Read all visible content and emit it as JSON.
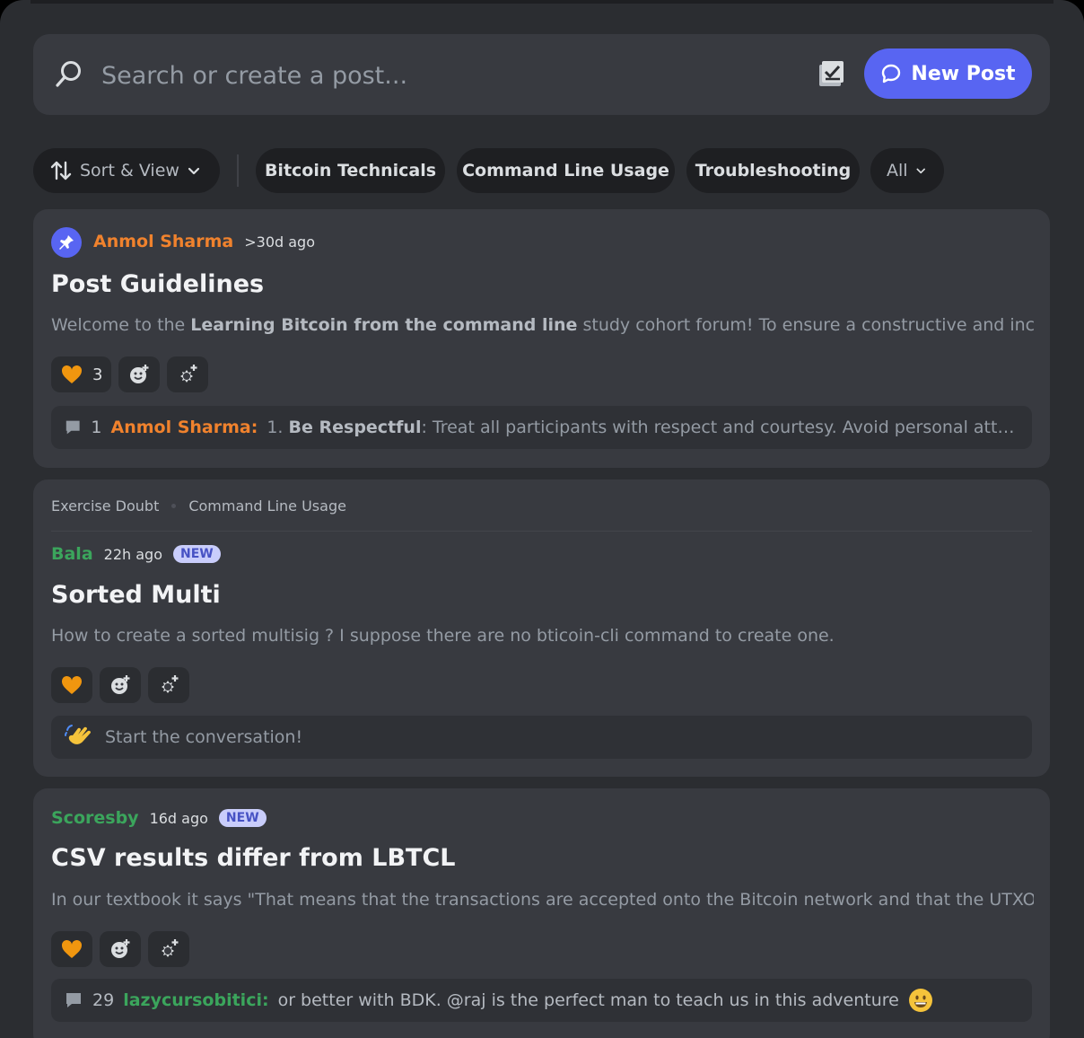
{
  "search": {
    "placeholder": "Search or create a post..."
  },
  "new_post_label": "New Post",
  "filters": {
    "sort_label": "Sort & View",
    "tags": [
      "Bitcoin Technicals",
      "Command Line Usage",
      "Troubleshooting"
    ],
    "all_label": "All"
  },
  "posts": [
    {
      "author": "Anmol Sharma",
      "author_color": "#f0822d",
      "time": ">30d ago",
      "title": "Post Guidelines",
      "excerpt_pre": "Welcome to the ",
      "excerpt_bold": "Learning Bitcoin from the command line",
      "excerpt_post": " study cohort forum! To ensure a constructive and inclusive ...",
      "heart_count": "3",
      "reply_count": "1",
      "reply_author": "Anmol Sharma:",
      "reply_pre": "1. ",
      "reply_bold": "Be Respectful",
      "reply_post": ": Treat all participants with respect and courtesy. Avoid personal attacks, of..."
    },
    {
      "tags": [
        "Exercise Doubt",
        "Command Line Usage"
      ],
      "author": "Bala",
      "author_color": "#3ba55c",
      "time": "22h ago",
      "badge": "NEW",
      "title": "Sorted Multi",
      "excerpt": "How to create a sorted multisig ? I suppose there are no bticoin-cli command to create one.",
      "cta": "Start the conversation!"
    },
    {
      "author": "Scoresby",
      "author_color": "#3ba55c",
      "time": "16d ago",
      "badge": "NEW",
      "title": "CSV results differ from LBTCL",
      "excerpt": "In our textbook it says \"That means that the transactions are accepted onto the Bitcoin network and that the UTXOs ...",
      "reply_count": "29",
      "reply_author": "lazycursobitici:",
      "reply_text": "or better with BDK. @raj is the perfect man   to teach us in this adventure"
    }
  ],
  "colors": {
    "accent": "#5865f2",
    "background": "#2b2d31",
    "card": "#383a40",
    "heart": "#f0960f"
  }
}
